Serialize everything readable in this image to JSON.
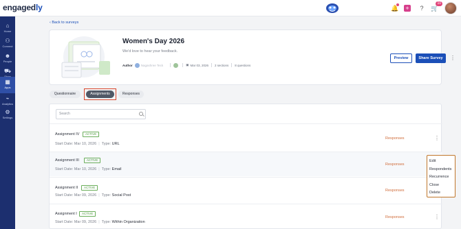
{
  "app": {
    "logo_main": "engaged",
    "logo_accent": "ly",
    "notification_count": "10"
  },
  "sidebar": {
    "items": [
      {
        "label": "Home",
        "icon": "home-icon"
      },
      {
        "label": "Connect",
        "icon": "connect-icon"
      },
      {
        "label": "People",
        "icon": "people-icon"
      },
      {
        "label": "Store",
        "icon": "cart-icon"
      },
      {
        "label": "Apps",
        "icon": "apps-icon",
        "active": true
      },
      {
        "label": "Analytics",
        "icon": "analytics-icon"
      },
      {
        "label": "Settings",
        "icon": "settings-icon"
      }
    ]
  },
  "nav": {
    "back_label": "Back to surveys"
  },
  "survey": {
    "title": "Women's Day 2026",
    "subtitle": "We'd love to hear your feedback.",
    "author_label": "Author",
    "author_name": "Nagashree Teck",
    "date": "Mar 03, 2026",
    "sections": "2 sections",
    "questions": "8 questions",
    "preview_label": "Preview",
    "share_label": "Share Survey"
  },
  "tabs": [
    {
      "label": "Questionnaire",
      "active": false
    },
    {
      "label": "Assignments",
      "active": true
    },
    {
      "label": "Responses",
      "active": false
    }
  ],
  "search": {
    "placeholder": "Search"
  },
  "assignments": [
    {
      "name": "Assignment IV",
      "status": "ACTIVE",
      "start_label": "Start Date:",
      "start_date": "Mar 10, 2026",
      "type_label": "Type:",
      "type": "URL",
      "responses_label": "Responses"
    },
    {
      "name": "Assignment III",
      "status": "ACTIVE",
      "start_label": "Start Date:",
      "start_date": "Mar 10, 2026",
      "type_label": "Type:",
      "type": "Email",
      "responses_label": "Responses"
    },
    {
      "name": "Assignment II",
      "status": "ACTIVE",
      "start_label": "Start Date:",
      "start_date": "Mar 09, 2026",
      "type_label": "Type:",
      "type": "Social Post",
      "responses_label": "Responses"
    },
    {
      "name": "Assignment I",
      "status": "ACTIVE",
      "start_label": "Start Date:",
      "start_date": "Mar 09, 2026",
      "type_label": "Type:",
      "type": "Within Organization",
      "responses_label": "Responses"
    }
  ],
  "context_menu": {
    "items": [
      "Edit",
      "Respondents",
      "Recurrence",
      "Close",
      "Delete"
    ]
  },
  "colors": {
    "primary": "#1b4fb8",
    "sidebar": "#1c2f6f",
    "active_green": "#4f9a3e",
    "responses_orange": "#d06d3b",
    "highlight_red": "#d9452b"
  }
}
